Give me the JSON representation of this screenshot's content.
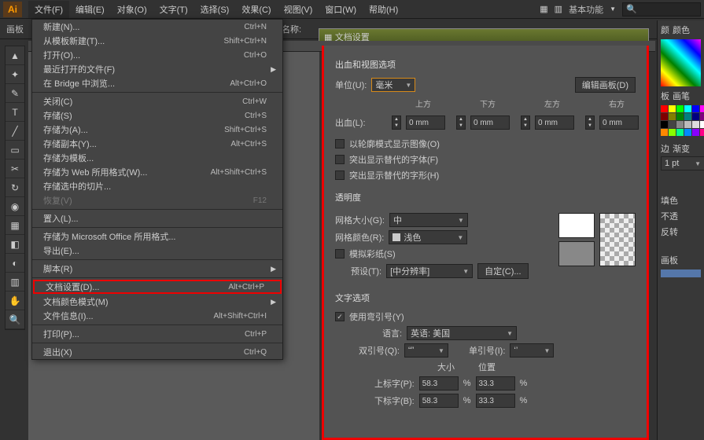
{
  "app": {
    "logo": "Ai"
  },
  "menubar": {
    "items": [
      "文件(F)",
      "编辑(E)",
      "对象(O)",
      "文字(T)",
      "选择(S)",
      "效果(C)",
      "视图(V)",
      "窗口(W)",
      "帮助(H)"
    ],
    "right_label": "基本功能"
  },
  "toolbar": {
    "left_label": "画板",
    "name_label": "名称:",
    "dialog_title": "文档设置"
  },
  "file_menu": [
    {
      "label": "新建(N)...",
      "shortcut": "Ctrl+N"
    },
    {
      "label": "从模板新建(T)...",
      "shortcut": "Shift+Ctrl+N"
    },
    {
      "label": "打开(O)...",
      "shortcut": "Ctrl+O"
    },
    {
      "label": "最近打开的文件(F)",
      "arrow": true
    },
    {
      "label": "在 Bridge 中浏览...",
      "shortcut": "Alt+Ctrl+O"
    },
    {
      "sep": true
    },
    {
      "label": "关闭(C)",
      "shortcut": "Ctrl+W"
    },
    {
      "label": "存储(S)",
      "shortcut": "Ctrl+S"
    },
    {
      "label": "存储为(A)...",
      "shortcut": "Shift+Ctrl+S"
    },
    {
      "label": "存储副本(Y)...",
      "shortcut": "Alt+Ctrl+S"
    },
    {
      "label": "存储为模板..."
    },
    {
      "label": "存储为 Web 所用格式(W)...",
      "shortcut": "Alt+Shift+Ctrl+S"
    },
    {
      "label": "存储选中的切片..."
    },
    {
      "label": "恢复(V)",
      "shortcut": "F12",
      "dim": true
    },
    {
      "sep": true
    },
    {
      "label": "置入(L)..."
    },
    {
      "sep": true
    },
    {
      "label": "存储为 Microsoft Office 所用格式..."
    },
    {
      "label": "导出(E)..."
    },
    {
      "sep": true
    },
    {
      "label": "脚本(R)",
      "arrow": true
    },
    {
      "sep": true
    },
    {
      "label": "文档设置(D)...",
      "shortcut": "Alt+Ctrl+P",
      "highlight": true
    },
    {
      "label": "文档颜色模式(M)",
      "arrow": true
    },
    {
      "label": "文件信息(I)...",
      "shortcut": "Alt+Shift+Ctrl+I"
    },
    {
      "sep": true
    },
    {
      "label": "打印(P)...",
      "shortcut": "Ctrl+P"
    },
    {
      "sep": true
    },
    {
      "label": "退出(X)",
      "shortcut": "Ctrl+Q"
    }
  ],
  "doc": {
    "section1": "出血和视图选项",
    "unit_label": "单位(U):",
    "unit_value": "毫米",
    "edit_artboard": "编辑画板(D)",
    "bleed_label": "出血(L):",
    "bleed_heads": [
      "上方",
      "下方",
      "左方",
      "右方"
    ],
    "bleed_vals": [
      "0 mm",
      "0 mm",
      "0 mm",
      "0 mm"
    ],
    "chk1": "以轮廓模式显示图像(O)",
    "chk2": "突出显示替代的字体(F)",
    "chk3": "突出显示替代的字形(H)",
    "section2": "透明度",
    "grid_size_label": "网格大小(G):",
    "grid_size_value": "中",
    "grid_color_label": "网格颜色(R):",
    "grid_color_value": "浅色",
    "chk4": "模拟彩纸(S)",
    "preset_label": "预设(T):",
    "preset_value": "[中分辨率]",
    "custom_btn": "自定(C)...",
    "section3": "文字选项",
    "chk5": "使用弯引号(Y)",
    "lang_label": "语言:",
    "lang_value": "英语: 美国",
    "dq_label": "双引号(Q):",
    "dq_value": "“”",
    "sq_label": "单引号(I):",
    "sq_value": "‘’",
    "size_label": "大小",
    "pos_label": "位置",
    "sup_label": "上标字(P):",
    "sup_size": "58.3",
    "sup_pos": "33.3",
    "sub_label": "下标字(B):",
    "sub_size": "58.3",
    "sub_pos": "33.3",
    "pct": "%"
  },
  "right": {
    "tab1": "颜",
    "tab2": "颜色",
    "tab3": "板",
    "tab4": "画笔",
    "tab5": "边",
    "tab6": "渐变",
    "stroke": "1 pt",
    "tab7": "填色",
    "tab8": "不透",
    "tab9": "反转",
    "tab10": "画板"
  },
  "tools": [
    "▲",
    "✦",
    "✎",
    "T",
    "╱",
    "▭",
    "✂",
    "↻",
    "◉",
    "▦",
    "◧",
    "◐",
    "▥",
    "✋",
    "🔍"
  ],
  "colors": [
    "#ff0000",
    "#ffff00",
    "#00ff00",
    "#00ffff",
    "#0000ff",
    "#ff00ff",
    "#800000",
    "#808000",
    "#008000",
    "#008080",
    "#000080",
    "#800080",
    "#000000",
    "#444444",
    "#888888",
    "#bbbbbb",
    "#dddddd",
    "#ffffff",
    "#ff8800",
    "#88ff00",
    "#00ff88",
    "#0088ff",
    "#8800ff",
    "#ff0088"
  ]
}
